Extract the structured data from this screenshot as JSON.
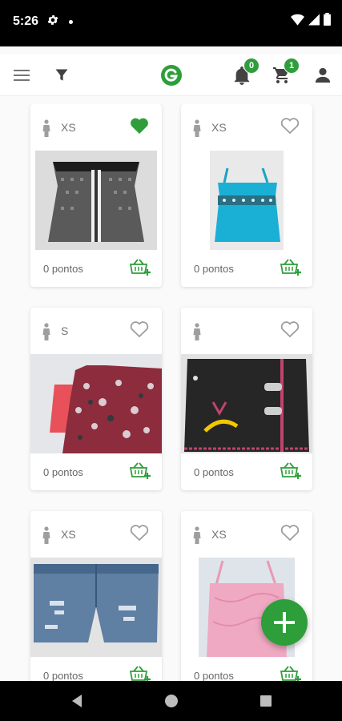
{
  "status_bar": {
    "time": "5:26"
  },
  "app_bar": {
    "notifications_count": "0",
    "cart_count": "1"
  },
  "colors": {
    "brand_green": "#2e9e3a",
    "heart_filled": "#2e9e3a",
    "outline_gray": "#9e9e9e"
  },
  "products": [
    {
      "size": "XS",
      "points": "0 pontos",
      "favorite": true,
      "photo": "gray-checkered-corset-top"
    },
    {
      "size": "XS",
      "points": "0 pontos",
      "favorite": false,
      "photo": "turquoise-camisole"
    },
    {
      "size": "S",
      "points": "0 pontos",
      "favorite": false,
      "photo": "floral-dress"
    },
    {
      "size": "",
      "points": "0 pontos",
      "favorite": false,
      "photo": "black-skirt"
    },
    {
      "size": "XS",
      "points": "0 pontos",
      "favorite": false,
      "photo": "denim-shorts"
    },
    {
      "size": "XS",
      "points": "0 pontos",
      "favorite": false,
      "photo": "pink-camisole"
    }
  ],
  "icons": {
    "menu": "menu-icon",
    "filter": "filter-icon",
    "logo": "logo-icon",
    "bell": "bell-icon",
    "cart": "cart-icon",
    "account": "person-icon",
    "add": "plus-icon",
    "size": "person-size-icon",
    "heart": "heart-icon",
    "basket": "basket-add-icon"
  }
}
